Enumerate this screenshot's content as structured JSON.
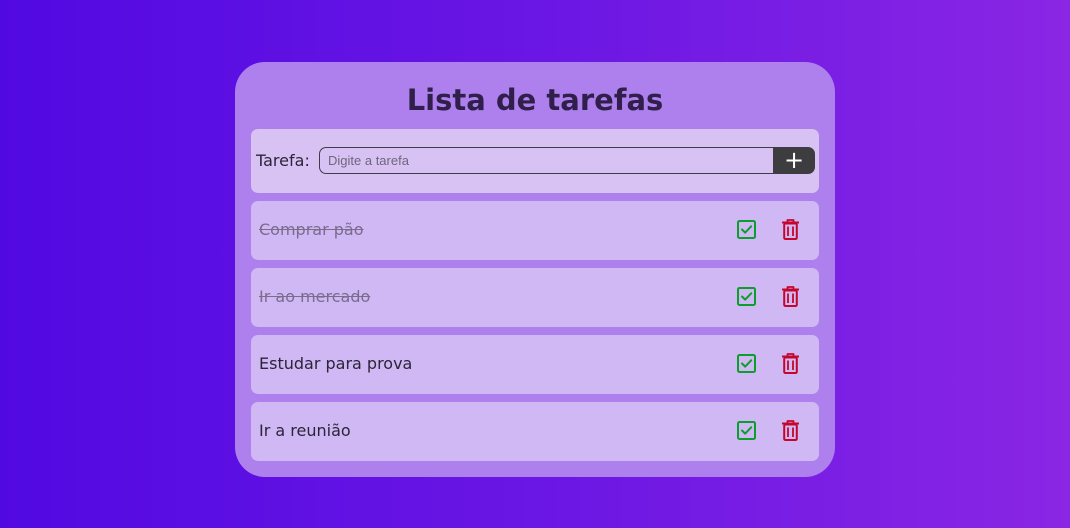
{
  "app": {
    "title": "Lista de tarefas"
  },
  "new_task": {
    "label": "Tarefa:",
    "placeholder": "Digite a tarefa",
    "value": "",
    "add_button_label": "+"
  },
  "tasks": [
    {
      "text": "Comprar pão",
      "done": true
    },
    {
      "text": "Ir ao mercado",
      "done": true
    },
    {
      "text": "Estudar para prova",
      "done": false
    },
    {
      "text": "Ir a reunião",
      "done": false
    }
  ],
  "icons": {
    "complete": "check-square-icon",
    "delete": "trash-icon"
  },
  "colors": {
    "background_start": "#5109e2",
    "background_end": "#8a26e4",
    "card": "#ad80ee",
    "task_row": "#cfb8f3",
    "check": "#0b9e2a",
    "delete": "#c4062c",
    "add_button": "#3d3d40"
  }
}
